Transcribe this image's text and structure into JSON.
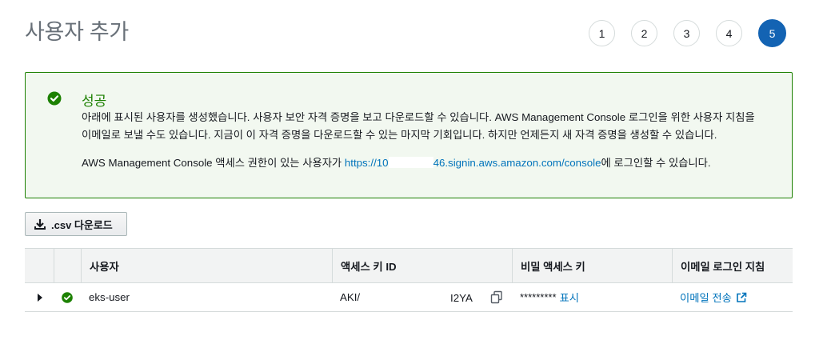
{
  "page": {
    "title": "사용자 추가"
  },
  "steps": [
    "1",
    "2",
    "3",
    "4",
    "5"
  ],
  "active_step": "5",
  "alert": {
    "title": "성공",
    "line1": "아래에 표시된 사용자를 생성했습니다. 사용자 보안 자격 증명을 보고 다운로드할 수 있습니다. AWS Management Console 로그인을 위한 사용자 지침을",
    "line2": "이메일로 보낼 수도 있습니다. 지금이 이 자격 증명을 다운로드할 수 있는 마지막 기회입니다. 하지만 언제든지 새 자격 증명을 생성할 수 있습니다.",
    "console_prefix": "AWS Management Console 액세스 권한이 있는 사용자가 ",
    "console_link_start": "https://10",
    "console_link_end": "46.signin.aws.amazon.com/console",
    "console_suffix": "에 로그인할 수 있습니다.",
    "colors": {
      "border": "#1d8102",
      "background": "#f2f8f0"
    }
  },
  "download_button": {
    "label": ".csv 다운로드",
    "icon": "download-icon"
  },
  "table": {
    "headers": [
      "사용자",
      "액세스 키 ID",
      "비밀 액세스 키",
      "이메일 로그인 지침"
    ],
    "rows": [
      {
        "user": "eks-user",
        "access_key_prefix": "AKI/",
        "access_key_suffix": "I2YA",
        "secret": "*********",
        "show_label": "표시",
        "email_label": "이메일 전송"
      }
    ]
  }
}
